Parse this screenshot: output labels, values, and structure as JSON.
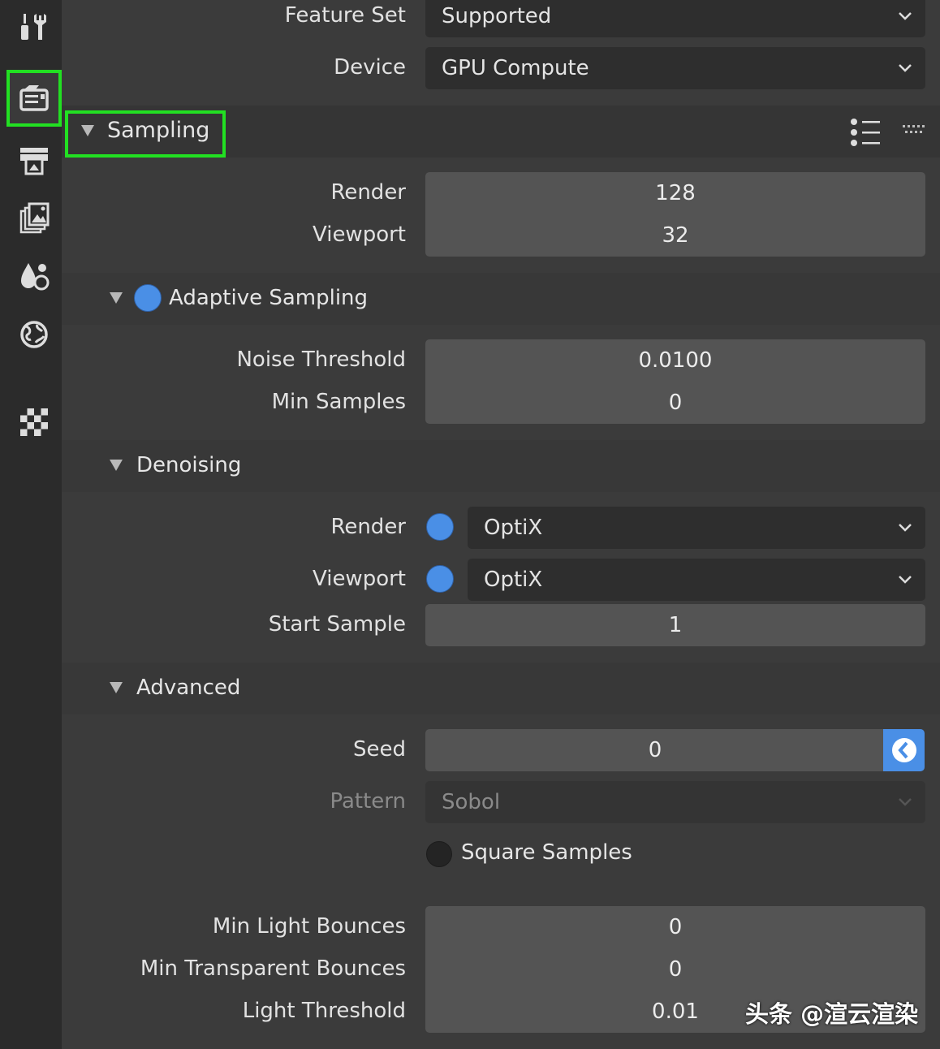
{
  "sidebar": {
    "tabs": [
      {
        "name": "tool-tab",
        "icon": "tool-icon"
      },
      {
        "name": "render-tab",
        "icon": "render-camera-icon",
        "active": true
      },
      {
        "name": "output-tab",
        "icon": "printer-icon"
      },
      {
        "name": "view-layer-tab",
        "icon": "image-stack-icon"
      },
      {
        "name": "scene-tab",
        "icon": "scene-icon"
      },
      {
        "name": "world-tab",
        "icon": "world-icon"
      },
      {
        "name": "texture-tab",
        "icon": "checker-icon"
      }
    ]
  },
  "top": {
    "feature_set_label": "Feature Set",
    "feature_set_value": "Supported",
    "device_label": "Device",
    "device_value": "GPU Compute"
  },
  "sampling": {
    "title": "Sampling",
    "render_label": "Render",
    "render_value": "128",
    "viewport_label": "Viewport",
    "viewport_value": "32"
  },
  "adaptive": {
    "title": "Adaptive Sampling",
    "enabled": true,
    "noise_label": "Noise Threshold",
    "noise_value": "0.0100",
    "min_samples_label": "Min Samples",
    "min_samples_value": "0"
  },
  "denoising": {
    "title": "Denoising",
    "render_label": "Render",
    "render_value": "OptiX",
    "viewport_label": "Viewport",
    "viewport_value": "OptiX",
    "start_sample_label": "Start Sample",
    "start_sample_value": "1"
  },
  "advanced": {
    "title": "Advanced",
    "seed_label": "Seed",
    "seed_value": "0",
    "pattern_label": "Pattern",
    "pattern_value": "Sobol",
    "square_samples_label": "Square Samples",
    "square_samples_checked": false,
    "min_light_label": "Min Light Bounces",
    "min_light_value": "0",
    "min_transparent_label": "Min Transparent Bounces",
    "min_transparent_value": "0",
    "light_threshold_label": "Light Threshold",
    "light_threshold_value": "0.01"
  },
  "watermark": "头条 @渲云渲染",
  "colors": {
    "accent_blue": "#4a8fe6",
    "highlight_green": "#22e022",
    "panel_bg": "#3b3b3b",
    "field_bg": "#545454"
  }
}
